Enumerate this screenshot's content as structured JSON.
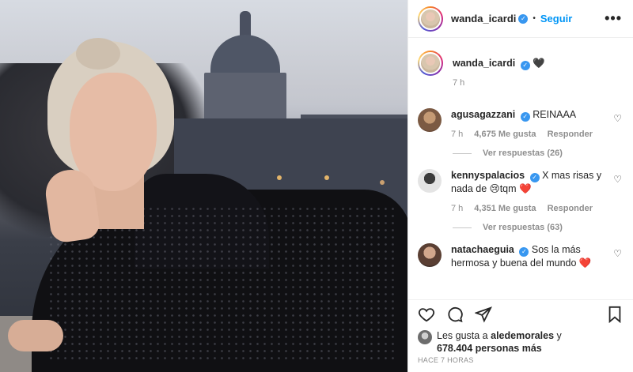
{
  "post": {
    "author": "wanda_icardi",
    "follow_label": "Seguir",
    "more_label": "•••"
  },
  "caption": {
    "username": "wanda_icardi",
    "emoji": "🖤",
    "time": "7 h"
  },
  "comments": [
    {
      "username": "agusagazzani",
      "text": "REINAAA",
      "time": "7 h",
      "likes": "4,675 Me gusta",
      "reply_label": "Responder",
      "replies_label": "Ver respuestas (26)"
    },
    {
      "username": "kennyspalacios",
      "text": "X mas risas y nada de 😢tqm ❤️",
      "time": "7 h",
      "likes": "4,351 Me gusta",
      "reply_label": "Responder",
      "replies_label": "Ver respuestas (63)"
    },
    {
      "username": "natachaeguia",
      "text": "Sos la más hermosa y buena del mundo ❤️"
    }
  ],
  "likes_summary": {
    "prefix": "Les gusta a",
    "user": "aledemorales",
    "connector": "y",
    "count": "678.404 personas más"
  },
  "timestamp": "HACE 7 HORAS",
  "icons": [
    "heart-icon",
    "comment-icon",
    "share-icon",
    "bookmark-icon",
    "more-options-icon",
    "verified-icon"
  ]
}
